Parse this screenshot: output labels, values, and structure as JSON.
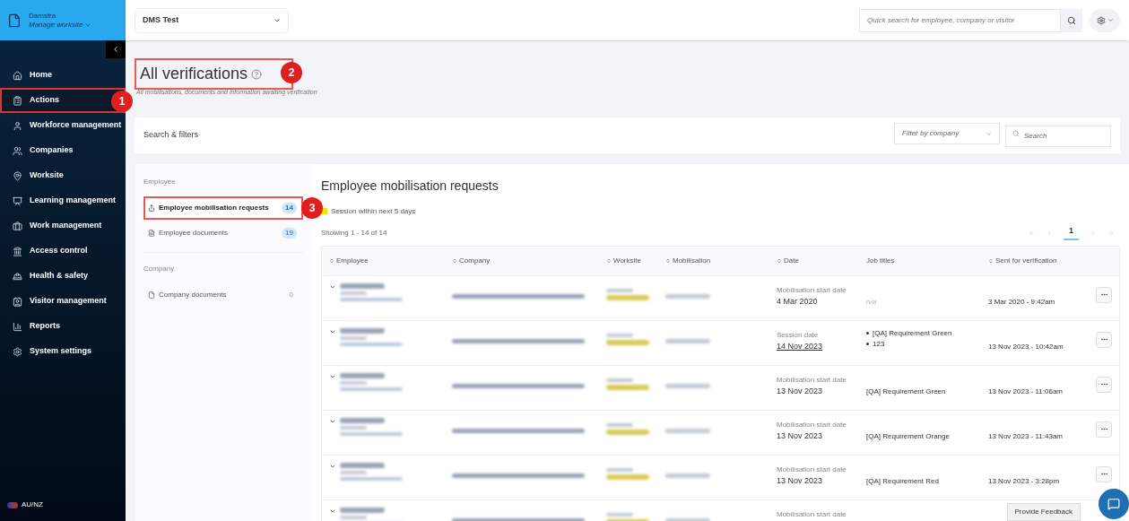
{
  "sidebar": {
    "brand": "Damstra",
    "worksite_menu": "Manage worksite",
    "items": [
      {
        "label": "Home",
        "selected": false
      },
      {
        "label": "Actions",
        "selected": true
      },
      {
        "label": "Workforce management",
        "selected": false
      },
      {
        "label": "Companies",
        "selected": false
      },
      {
        "label": "Worksite",
        "selected": false
      },
      {
        "label": "Learning management",
        "selected": false
      },
      {
        "label": "Work management",
        "selected": false
      },
      {
        "label": "Access control",
        "selected": false
      },
      {
        "label": "Health & safety",
        "selected": false
      },
      {
        "label": "Visitor management",
        "selected": false
      },
      {
        "label": "Reports",
        "selected": false
      },
      {
        "label": "System settings",
        "selected": false
      }
    ],
    "region": "AU/NZ"
  },
  "topbar": {
    "project": "DMS Test",
    "quick_search": {
      "placeholder": "Quick search for employee, company or visitor"
    }
  },
  "page": {
    "title": "All verifications",
    "subtitle": "All mobilisations, documents and information awaiting verification"
  },
  "filters": {
    "title": "Search & filters",
    "company_filter": {
      "placeholder": "Filter by company"
    },
    "search": {
      "placeholder": "Search"
    }
  },
  "categories": [
    {
      "heading": "Employee",
      "items": [
        {
          "label": "Employee mobilisation requests",
          "count": "14",
          "selected": true
        },
        {
          "label": "Employee documents",
          "count": "19",
          "selected": false
        }
      ]
    },
    {
      "heading": "Company",
      "items": [
        {
          "label": "Company documents",
          "count": "0",
          "selected": false
        }
      ]
    }
  ],
  "requests": {
    "title": "Employee mobilisation requests",
    "legend": "Session within next 5 days",
    "showing": "Showing 1 - 14 of 14",
    "pages": [
      {
        "label": "1",
        "selected": true
      }
    ],
    "columns": [
      {
        "label": "Employee",
        "sortable": true
      },
      {
        "label": "Company",
        "sortable": true
      },
      {
        "label": "Worksite",
        "sortable": true
      },
      {
        "label": "Mobilisation",
        "sortable": true
      },
      {
        "label": "Date",
        "sortable": true
      },
      {
        "label": "Job titles",
        "sortable": false
      },
      {
        "label": "Sent for verification",
        "sortable": true
      }
    ],
    "rows": [
      {
        "date_label": "Mobilisation start date",
        "date": "4 Mar 2020",
        "date_link": false,
        "jobs_muted": true,
        "job_titles": [
          "n/a"
        ],
        "sent": "3 Mar 2020 - 9:42am"
      },
      {
        "date_label": "Session date",
        "date": "14 Nov 2023",
        "date_link": true,
        "jobs_muted": false,
        "job_titles": [
          "[QA] Requirement Green",
          "123"
        ],
        "sent": "13 Nov 2023 - 10:42am"
      },
      {
        "date_label": "Mobilisation start date",
        "date": "13 Nov 2023",
        "date_link": false,
        "jobs_muted": false,
        "job_titles": [
          "[QA] Requirement Green"
        ],
        "sent": "13 Nov 2023 - 11:06am"
      },
      {
        "date_label": "Mobilisation start date",
        "date": "13 Nov 2023",
        "date_link": false,
        "jobs_muted": false,
        "job_titles": [
          "[QA] Requirement Orange"
        ],
        "sent": "13 Nov 2023 - 11:43am"
      },
      {
        "date_label": "Mobilisation start date",
        "date": "13 Nov 2023",
        "date_link": false,
        "jobs_muted": false,
        "job_titles": [
          "[QA] Requirement Red"
        ],
        "sent": "13 Nov 2023 - 3:28pm"
      },
      {
        "date_label": "Mobilisation start date"
      }
    ]
  },
  "annotations": [
    {
      "label": "1"
    },
    {
      "label": "2"
    },
    {
      "label": "3"
    }
  ],
  "feedback": "Provide Feedback"
}
